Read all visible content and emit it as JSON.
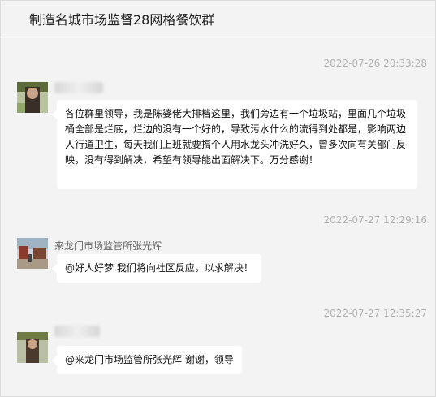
{
  "chat": {
    "title": "制造名城市场监督28网格餐饮群"
  },
  "messages": [
    {
      "timestamp": "2022-07-26 20:33:28",
      "sender": "",
      "text": "各位群里领导，我是陈婆佬大排档这里，我们旁边有一个垃圾站，里面几个垃圾桶全部是烂底，烂边的没有一个好的，导致污水什么的流得到处都是，影响两边人行道卫生，每天我们上班就要搞个人用水龙头冲洗好久，曾多次向有关部门反映，没有得到解决，希望有领导能出面解决下。万分感谢！"
    },
    {
      "timestamp": "2022-07-27 12:29:16",
      "sender": "来龙门市场监管所张光辉",
      "text": "@好人好梦 我们将向社区反应，以求解决！"
    },
    {
      "timestamp": "2022-07-27 12:35:27",
      "sender": "",
      "text": "@来龙门市场监管所张光辉 谢谢，领导"
    }
  ]
}
